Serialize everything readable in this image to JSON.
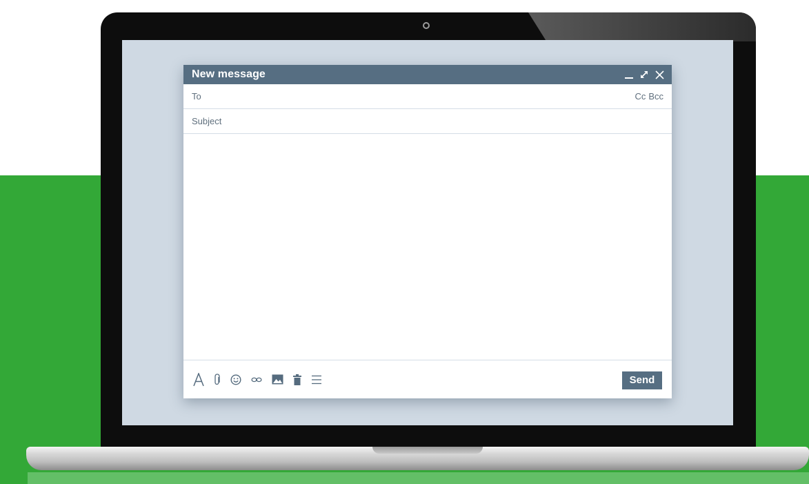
{
  "compose": {
    "title": "New message",
    "window_controls": {
      "minimize_icon": "minimize-icon",
      "expand_icon": "expand-icon",
      "close_icon": "close-icon"
    },
    "to_placeholder": "To",
    "cc_label": "Cc",
    "bcc_label": "Bcc",
    "subject_placeholder": "Subject",
    "toolbar_icons": [
      "format-text-icon",
      "attach-icon",
      "emoji-icon",
      "link-icon",
      "image-icon",
      "trash-icon",
      "more-options-icon"
    ],
    "send_label": "Send"
  },
  "colors": {
    "accent": "#566e82",
    "screen_bg": "#cfd9e3",
    "background_green": "#33a837"
  }
}
